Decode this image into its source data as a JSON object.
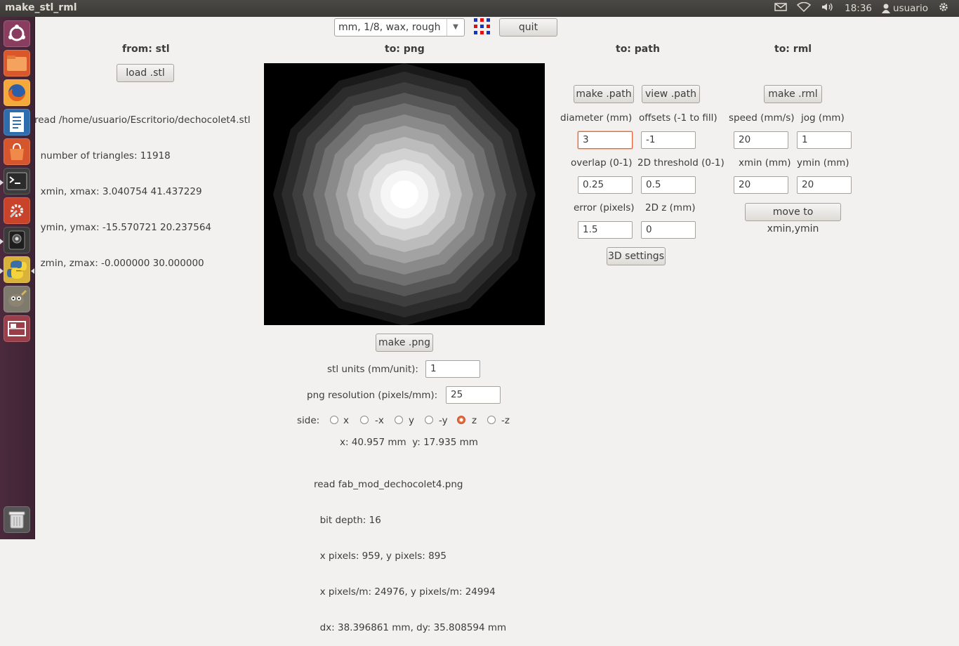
{
  "window": {
    "title": "make_stl_rml"
  },
  "tray": {
    "time": "18:36",
    "user": "usuario",
    "icons": [
      "mail-icon",
      "wifi-icon",
      "volume-icon",
      "user-icon",
      "power-gear-icon"
    ]
  },
  "launcher": {
    "items": [
      "ubuntu-dash-icon",
      "files-icon",
      "firefox-icon",
      "writer-icon",
      "software-center-icon",
      "terminal-icon",
      "settings-icon",
      "camera-icon",
      "python-icon",
      "gimp-icon",
      "workspaces-icon",
      "trash-icon"
    ]
  },
  "toolbar": {
    "format": "mm, 1/8, wax, rough",
    "quit": "quit",
    "logo": "fab-logo-icon"
  },
  "stl": {
    "header": "from: stl",
    "load": "load .stl",
    "info": [
      "read /home/usuario/Escritorio/dechocolet4.stl",
      "  number of triangles: 11918",
      "  xmin, xmax: 3.040754 41.437229",
      "  ymin, ymax: -15.570721 20.237564",
      "  zmin, zmax: -0.000000 30.000000"
    ]
  },
  "png": {
    "header": "to: png",
    "make": "make .png",
    "units_label": "stl units (mm/unit):",
    "units": "1",
    "res_label": "png resolution (pixels/mm):",
    "res": "25",
    "side_label": "side:",
    "sides": [
      "x",
      "-x",
      "y",
      "-y",
      "z",
      "-z"
    ],
    "selected_side": "z",
    "coords": "x: 40.957 mm  y: 17.935 mm",
    "info": [
      "read fab_mod_dechocolet4.png",
      "  bit depth: 16",
      "  x pixels: 959, y pixels: 895",
      "  x pixels/m: 24976, y pixels/m: 24994",
      "  dx: 38.396861 mm, dy: 35.808594 mm"
    ]
  },
  "path": {
    "header": "to: path",
    "make": "make .path",
    "view": "view .path",
    "diameter_label": "diameter (mm)",
    "diameter": "3",
    "offsets_label": "offsets (-1 to fill)",
    "offsets": "-1",
    "overlap_label": "overlap (0-1)",
    "overlap": "0.25",
    "threshold_label": "2D threshold (0-1)",
    "threshold": "0.5",
    "error_label": "error (pixels)",
    "error": "1.5",
    "z_label": "2D z (mm)",
    "z": "0",
    "settings3d": "3D settings"
  },
  "rml": {
    "header": "to: rml",
    "make": "make .rml",
    "speed_label": "speed (mm/s)",
    "speed": "20",
    "jog_label": "jog (mm)",
    "jog": "1",
    "xmin_label": "xmin (mm)",
    "xmin": "20",
    "ymin_label": "ymin (mm)",
    "ymin": "20",
    "move": "move to xmin,ymin"
  }
}
